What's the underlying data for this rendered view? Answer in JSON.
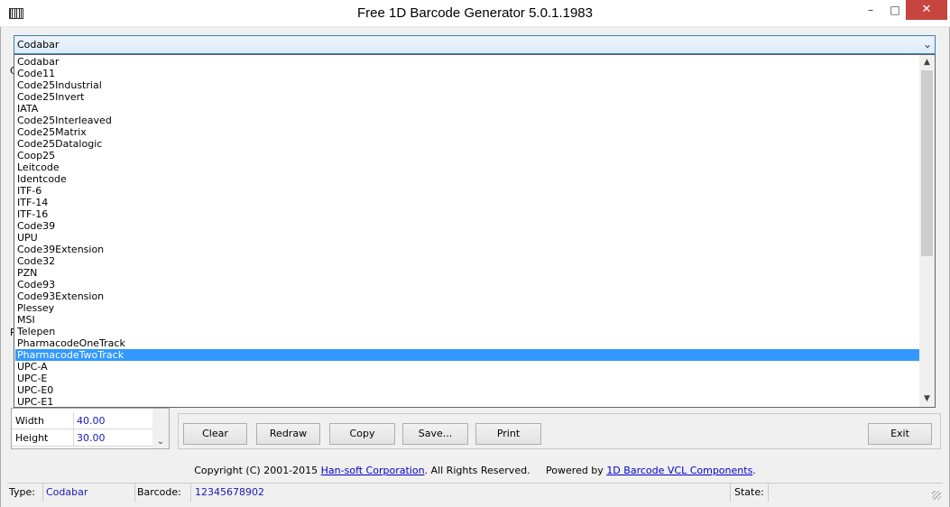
{
  "window": {
    "title": "Free 1D Barcode Generator 5.0.1.1983",
    "minimize_glyph": "–",
    "maximize_glyph": "□",
    "close_glyph": "✕"
  },
  "combo": {
    "value": "Codabar",
    "arrow": "⌄"
  },
  "dropdown": {
    "selected_index": 25,
    "items": [
      "Codabar",
      "Code11",
      "Code25Industrial",
      "Code25Invert",
      "IATA",
      "Code25Interleaved",
      "Code25Matrix",
      "Code25Datalogic",
      "Coop25",
      "Leitcode",
      "Identcode",
      "ITF-6",
      "ITF-14",
      "ITF-16",
      "Code39",
      "UPU",
      "Code39Extension",
      "Code32",
      "PZN",
      "Code93",
      "Code93Extension",
      "Plessey",
      "MSI",
      "Telepen",
      "PharmacodeOneTrack",
      "PharmacodeTwoTrack",
      "UPC-A",
      "UPC-E",
      "UPC-E0",
      "UPC-E1"
    ],
    "scroll_up_glyph": "▲",
    "scroll_down_glyph": "▼"
  },
  "properties": {
    "rows": [
      {
        "name": "Width",
        "value": "40.00"
      },
      {
        "name": "Height",
        "value": "30.00"
      }
    ],
    "scroll_down_glyph": "⌄"
  },
  "left_edge": {
    "glyph_top": "C",
    "glyph_bottom": "P"
  },
  "buttons": {
    "clear": "Clear",
    "redraw": "Redraw",
    "copy": "Copy",
    "save": "Save...",
    "print": "Print",
    "exit": "Exit"
  },
  "footer": {
    "copyright_prefix": "Copyright (C) 2001-2015",
    "company_link": "Han-soft Corporation",
    "rights": ". All Rights Reserved.",
    "powered_by": "Powered by",
    "vcl_link": "1D Barcode VCL Components",
    "period": "."
  },
  "status": {
    "type_label": "Type:",
    "type_value": "Codabar",
    "barcode_label": "Barcode:",
    "barcode_value": "12345678902",
    "state_label": "State:",
    "state_value": ""
  },
  "colors": {
    "selection": "#3399ff",
    "value_text": "#1a1ab4",
    "link": "#0000cc",
    "close_button": "#c7453e"
  }
}
